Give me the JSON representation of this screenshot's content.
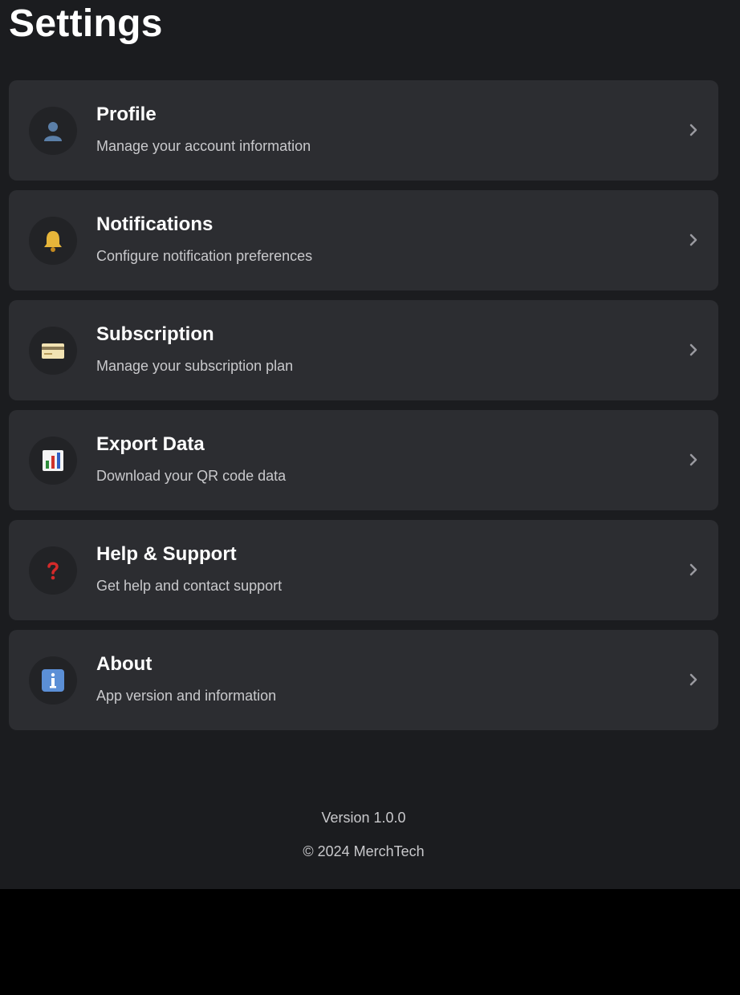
{
  "page": {
    "title": "Settings"
  },
  "settings": {
    "items": [
      {
        "title": "Profile",
        "subtitle": "Manage your account information",
        "icon": "user-icon"
      },
      {
        "title": "Notifications",
        "subtitle": "Configure notification preferences",
        "icon": "bell-icon"
      },
      {
        "title": "Subscription",
        "subtitle": "Manage your subscription plan",
        "icon": "credit-card-icon"
      },
      {
        "title": "Export Data",
        "subtitle": "Download your QR code data",
        "icon": "bar-chart-icon"
      },
      {
        "title": "Help & Support",
        "subtitle": "Get help and contact support",
        "icon": "question-mark-icon"
      },
      {
        "title": "About",
        "subtitle": "App version and information",
        "icon": "info-icon"
      }
    ]
  },
  "footer": {
    "version": "Version 1.0.0",
    "copyright": "© 2024 MerchTech"
  },
  "colors": {
    "background": "#1b1c1f",
    "card": "#2c2d31",
    "icon_circle": "#222326",
    "text_primary": "#ffffff",
    "text_secondary": "#c9c9cc",
    "chevron": "#9a9aa0"
  }
}
